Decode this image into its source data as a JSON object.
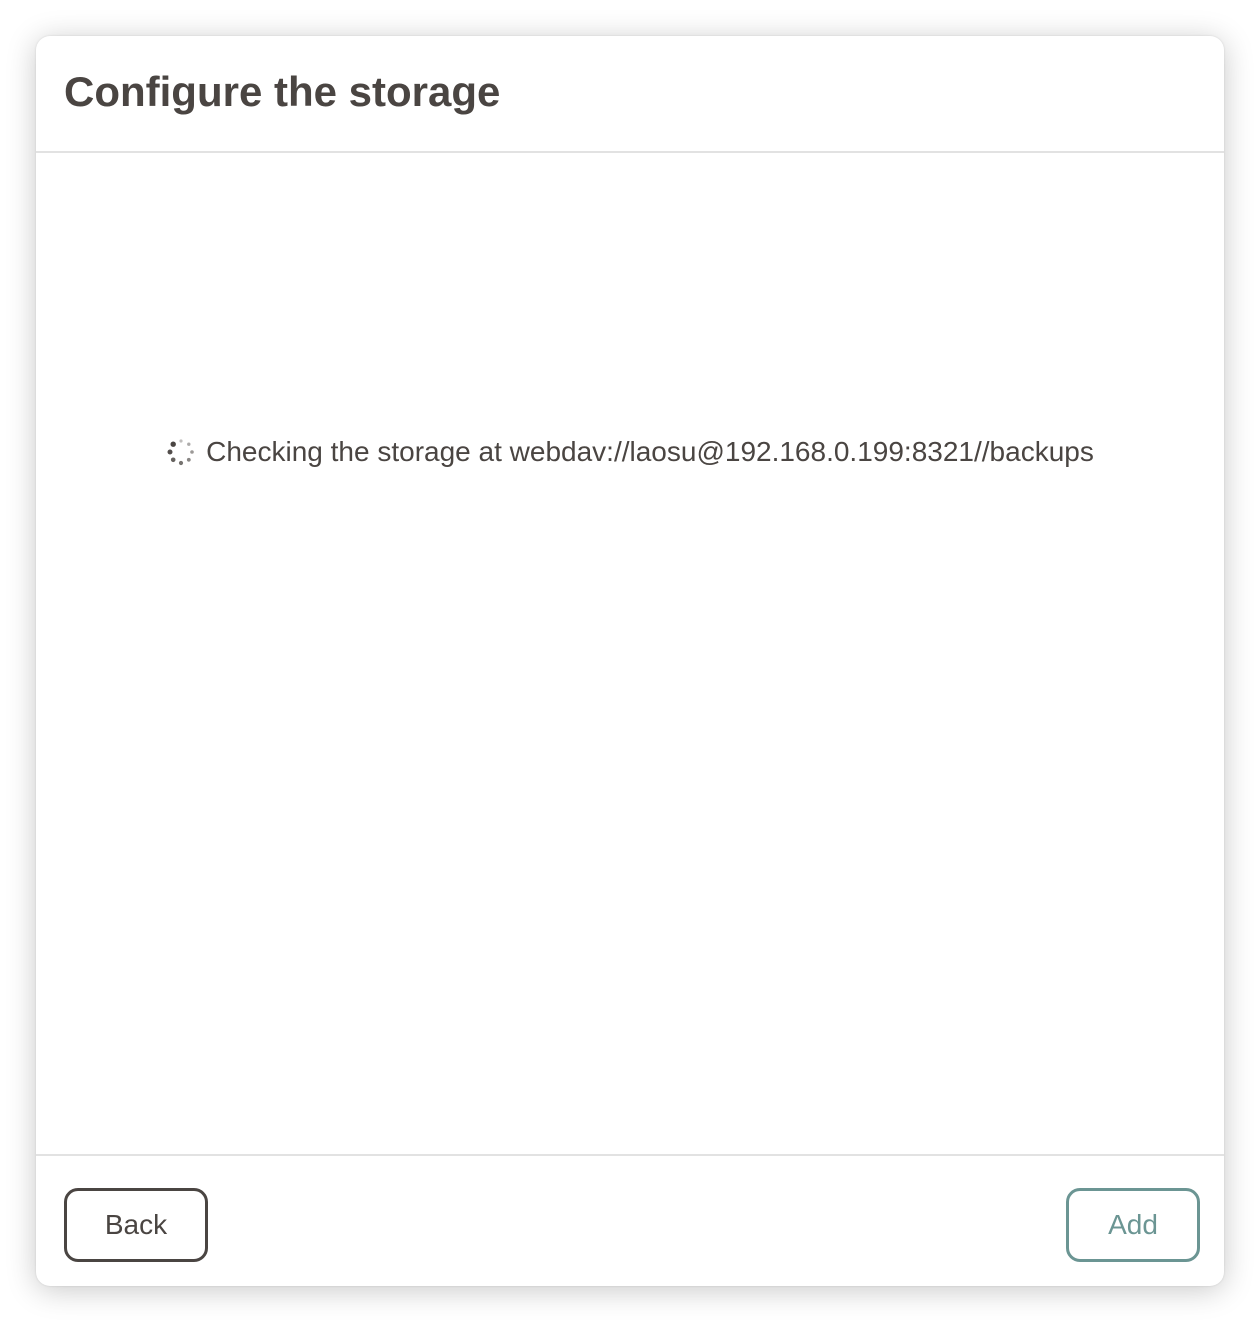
{
  "dialog": {
    "title": "Configure the storage",
    "status": {
      "icon": "loading-spinner-icon",
      "text": "Checking the storage at webdav://laosu@192.168.0.199:8321//backups"
    },
    "buttons": {
      "back_label": "Back",
      "add_label": "Add"
    }
  },
  "colors": {
    "text": "#4a4542",
    "accent": "#6b9593",
    "divider": "#e2e2e2"
  }
}
